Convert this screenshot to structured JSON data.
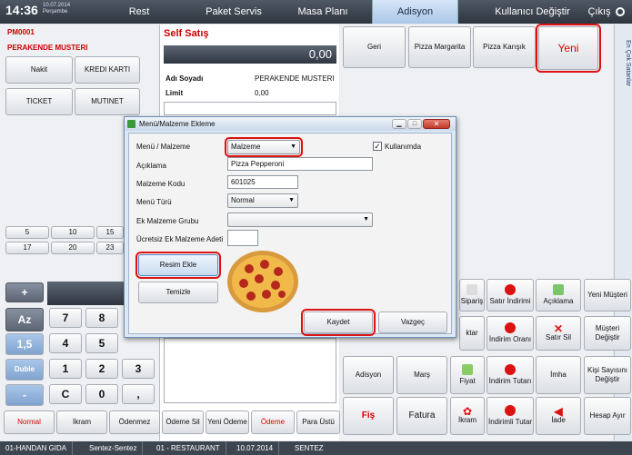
{
  "topbar": {
    "time": "14:36",
    "date": "10.07.2014",
    "day": "Perşembe",
    "tabs": [
      "Rest",
      "Paket Servis",
      "Masa Planı",
      "Adisyon"
    ],
    "user_switch": "Kullanıcı Değiştir",
    "exit": "Çıkış"
  },
  "left": {
    "code": "PM0001",
    "customer": "PERAKENDE MUSTERI",
    "payments": [
      "Nakit",
      "KREDI KARTI",
      "TICKET",
      "MUTINET"
    ],
    "quick_numbers": [
      "5",
      "10",
      "15",
      "17",
      "20",
      "23"
    ]
  },
  "center": {
    "title": "Self Satış",
    "amount": "0,00",
    "name_label": "Adı Soyadı",
    "name_value": "PERAKENDE MUSTERI",
    "limit_label": "Limit",
    "limit_value": "0,00"
  },
  "top_buttons": {
    "back": "Geri",
    "pizza1": "Pizza Margarita",
    "pizza2": "Pizza Karışık",
    "new": "Yeni"
  },
  "side_tab": "En Çok Satanlar",
  "keypad": {
    "plus": "+",
    "az": "Az",
    "k7": "7",
    "k8": "8",
    "k15": "1,5",
    "k4": "4",
    "k5": "5",
    "double": "Duble",
    "k1": "1",
    "k2": "2",
    "k3": "3",
    "minus": "-",
    "clear": "C",
    "k0": "0",
    ",": ","
  },
  "bottom_left": {
    "normal": "Normal",
    "ikram": "İkram",
    "odenmez": "Ödenmez"
  },
  "bottom_mid": {
    "pay_delete": "Ödeme Sil",
    "new_pay": "Yeni Ödeme",
    "pay": "Ödeme",
    "change": "Para Üstü"
  },
  "actions": {
    "siparis": "Sipariş",
    "satir_indirimi": "Satır İndirimi",
    "aciklama": "Açıklama",
    "yeni_musteri": "Yeni Müşteri",
    "aktar": "ktar",
    "indirim_orani": "İndirim Oranı",
    "satir_sil": "Satır Sil",
    "musteri_degistir": "Müşteri Değiştir",
    "adisyon": "Adisyon",
    "mars": "Marş",
    "fiyat": "Fiyat",
    "indirim_tutari": "İndirim Tutarı",
    "imha": "İmha",
    "kisi_sayisi": "Kişi Sayısını Değiştir",
    "fis": "Fiş",
    "fatura": "Fatura",
    "ikram": "İkram",
    "indirimli_tutar": "İndirimli Tutar",
    "iade": "İade",
    "hesap_ayir": "Hesap Ayır"
  },
  "dialog": {
    "title": "Menü/Malzeme Ekleme",
    "menu_label": "Menü / Malzeme",
    "menu_value": "Malzeme",
    "active_label": "Kullanımda",
    "desc_label": "Açıklama",
    "desc_value": "Pizza Pepperoni",
    "code_label": "Malzeme Kodu",
    "code_value": "601025",
    "type_label": "Menü Türü",
    "type_value": "Normal",
    "group_label": "Ek Malzeme Grubu",
    "free_label": "Ücretsiz Ek Malzeme Adeti",
    "add_image": "Resim Ekle",
    "clear": "Temizle",
    "save": "Kaydet",
    "cancel": "Vazgeç"
  },
  "footer": {
    "items": [
      "01-HANDAN GIDA",
      "Sentez-Sentez",
      "01 - RESTAURANT",
      "10.07.2014",
      "SENTEZ"
    ]
  },
  "colors": {
    "highlight": "#d11111",
    "topbar": "#3a424d",
    "red_text": "#dd0000"
  }
}
